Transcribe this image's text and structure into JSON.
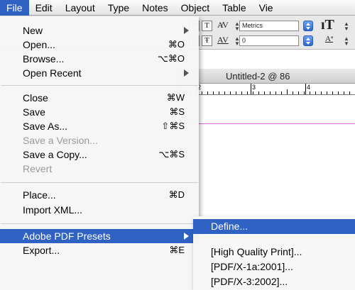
{
  "menubar": {
    "items": [
      "File",
      "Edit",
      "Layout",
      "Type",
      "Notes",
      "Object",
      "Table",
      "Vie"
    ],
    "active_index": 0
  },
  "control_panel": {
    "superscript_label": "T¹",
    "subscript_label": "T₁",
    "underline_label": "T",
    "strike_label": "Ŧ",
    "kerning_value": "Metrics",
    "tracking_value": "0",
    "vertical_scale_icon": "vertical-scale-icon",
    "baseline_shift_icon": "baseline-shift-icon"
  },
  "document": {
    "title": "Untitled-2 @ 86",
    "ruler_labels": [
      "2",
      "3",
      "4"
    ]
  },
  "file_menu": {
    "items": [
      {
        "label": "New",
        "shortcut": "",
        "submenu": true,
        "enabled": true
      },
      {
        "label": "Open...",
        "shortcut": "⌘O",
        "submenu": false,
        "enabled": true
      },
      {
        "label": "Browse...",
        "shortcut": "⌥⌘O",
        "submenu": false,
        "enabled": true
      },
      {
        "label": "Open Recent",
        "shortcut": "",
        "submenu": true,
        "enabled": true
      },
      {
        "label": "Close",
        "shortcut": "⌘W",
        "submenu": false,
        "enabled": true
      },
      {
        "label": "Save",
        "shortcut": "⌘S",
        "submenu": false,
        "enabled": true
      },
      {
        "label": "Save As...",
        "shortcut": "⇧⌘S",
        "submenu": false,
        "enabled": true
      },
      {
        "label": "Save a Version...",
        "shortcut": "",
        "submenu": false,
        "enabled": false
      },
      {
        "label": "Save a Copy...",
        "shortcut": "⌥⌘S",
        "submenu": false,
        "enabled": true
      },
      {
        "label": "Revert",
        "shortcut": "",
        "submenu": false,
        "enabled": false
      },
      {
        "label": "Place...",
        "shortcut": "⌘D",
        "submenu": false,
        "enabled": true
      },
      {
        "label": "Import XML...",
        "shortcut": "",
        "submenu": false,
        "enabled": true
      },
      {
        "label": "Adobe PDF Presets",
        "shortcut": "",
        "submenu": true,
        "enabled": true,
        "highlighted": true
      },
      {
        "label": "Export...",
        "shortcut": "⌘E",
        "submenu": false,
        "enabled": true
      }
    ]
  },
  "pdf_presets_submenu": {
    "items": [
      {
        "label": "Define...",
        "highlighted": true
      },
      {
        "label": "[High Quality Print]..."
      },
      {
        "label": "[PDF/X-1a:2001]..."
      },
      {
        "label": "[PDF/X-3:2002]..."
      }
    ]
  },
  "colors": {
    "highlight": "#2f62c3",
    "guide": "#d06ad6"
  }
}
